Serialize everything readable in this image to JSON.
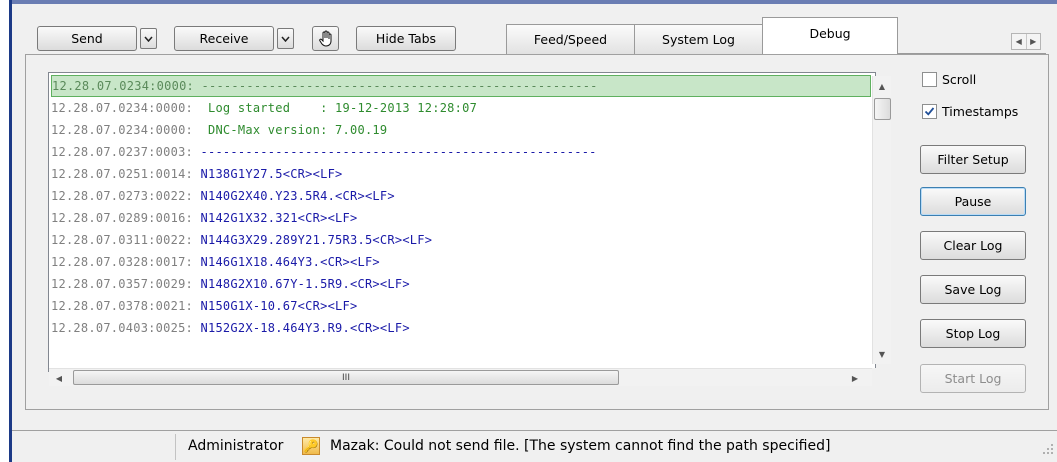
{
  "toolbar": {
    "send_label": "Send",
    "receive_label": "Receive",
    "hide_tabs_label": "Hide Tabs",
    "hand_icon": "hand-icon",
    "dropdown_icon": "chevron-down-icon"
  },
  "tabs": [
    {
      "label": "Feed/Speed",
      "active": false
    },
    {
      "label": "System Log",
      "active": false
    },
    {
      "label": "Debug",
      "active": true
    }
  ],
  "log": {
    "lines": [
      {
        "ts": "12.28.07.0234:0000:",
        "msg": " -----------------------------------------------------",
        "color": "#5a8a5a",
        "highlighted": true
      },
      {
        "ts": "12.28.07.0234:0000:",
        "msg": "  Log started    : 19-12-2013 12:28:07",
        "color": "#2e8b2e",
        "highlighted": false
      },
      {
        "ts": "12.28.07.0234:0000:",
        "msg": "  DNC-Max version: 7.00.19",
        "color": "#2e8b2e",
        "highlighted": false
      },
      {
        "ts": "12.28.07.0237:0003:",
        "msg": " -----------------------------------------------------",
        "color": "#1a1aa8",
        "highlighted": false
      },
      {
        "ts": "12.28.07.0251:0014:",
        "msg": " N138G1Y27.5<CR><LF>",
        "color": "#1a1aa8",
        "highlighted": false
      },
      {
        "ts": "12.28.07.0273:0022:",
        "msg": " N140G2X40.Y23.5R4.<CR><LF>",
        "color": "#1a1aa8",
        "highlighted": false
      },
      {
        "ts": "12.28.07.0289:0016:",
        "msg": " N142G1X32.321<CR><LF>",
        "color": "#1a1aa8",
        "highlighted": false
      },
      {
        "ts": "12.28.07.0311:0022:",
        "msg": " N144G3X29.289Y21.75R3.5<CR><LF>",
        "color": "#1a1aa8",
        "highlighted": false
      },
      {
        "ts": "12.28.07.0328:0017:",
        "msg": " N146G1X18.464Y3.<CR><LF>",
        "color": "#1a1aa8",
        "highlighted": false
      },
      {
        "ts": "12.28.07.0357:0029:",
        "msg": " N148G2X10.67Y-1.5R9.<CR><LF>",
        "color": "#1a1aa8",
        "highlighted": false
      },
      {
        "ts": "12.28.07.0378:0021:",
        "msg": " N150G1X-10.67<CR><LF>",
        "color": "#1a1aa8",
        "highlighted": false
      },
      {
        "ts": "12.28.07.0403:0025:",
        "msg": " N152G2X-18.464Y3.R9.<CR><LF>",
        "color": "#1a1aa8",
        "highlighted": false
      }
    ],
    "hscroll_thumb_label": "III"
  },
  "options": {
    "scroll_label": "Scroll",
    "scroll_checked": false,
    "timestamps_label": "Timestamps",
    "timestamps_checked": true
  },
  "actions": {
    "filter_setup": "Filter Setup",
    "pause": "Pause",
    "clear_log": "Clear Log",
    "save_log": "Save Log",
    "stop_log": "Stop Log",
    "start_log": "Start Log"
  },
  "status": {
    "user": "Administrator",
    "message": "Mazak: Could not send file. [The system cannot find the path specified]",
    "icon": "key-icon"
  }
}
